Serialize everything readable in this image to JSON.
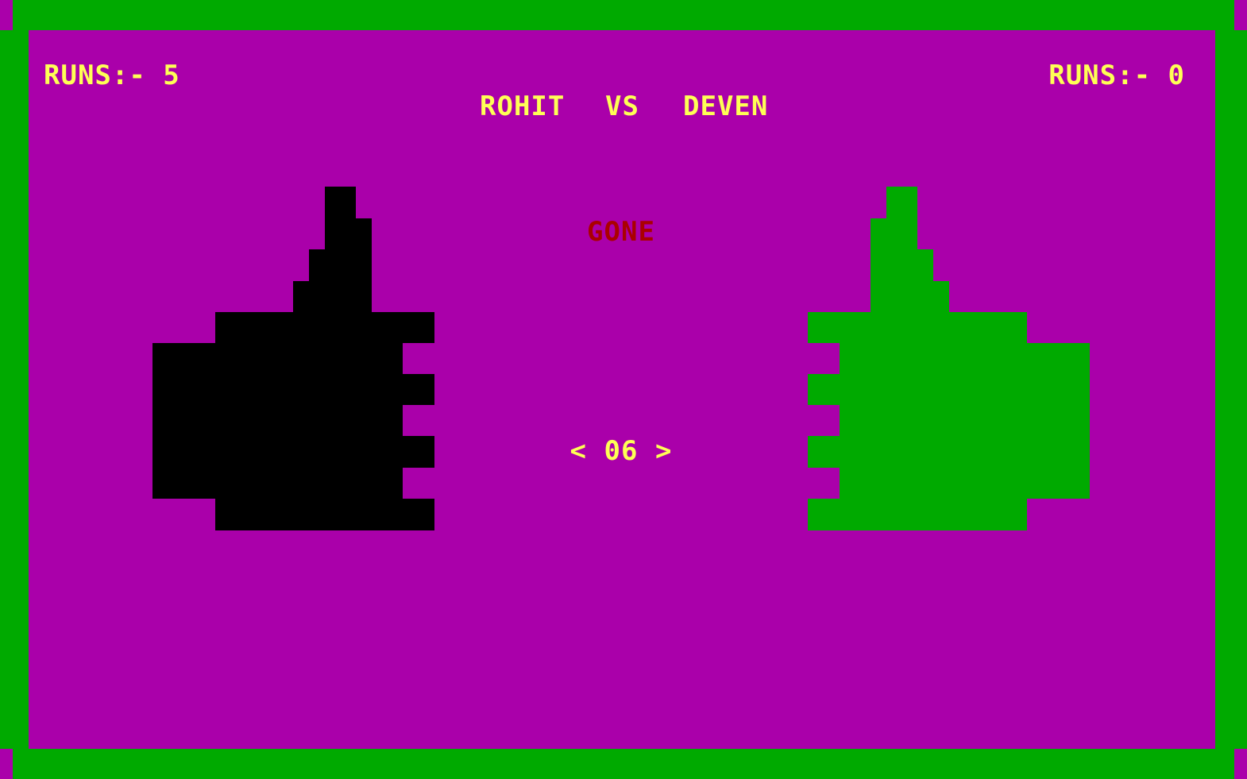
{
  "scoreboard": {
    "player1_runs": "RUNS:- 5",
    "player2_runs": "RUNS:- 0"
  },
  "match": {
    "player1_name": "ROHIT",
    "vs": "VS",
    "player2_name": "DEVEN"
  },
  "status_text": "GONE",
  "selector": {
    "left_arrow": "<",
    "value": "06",
    "right_arrow": ">"
  },
  "hands": {
    "left": {
      "icon": "thumbs-up-icon",
      "color": "#000000"
    },
    "right": {
      "icon": "thumbs-up-icon",
      "color": "#00AA00"
    }
  },
  "colors": {
    "border": "#00AA00",
    "field": "#AA00AA",
    "text": "#FFFF55",
    "status": "#AA0000"
  }
}
